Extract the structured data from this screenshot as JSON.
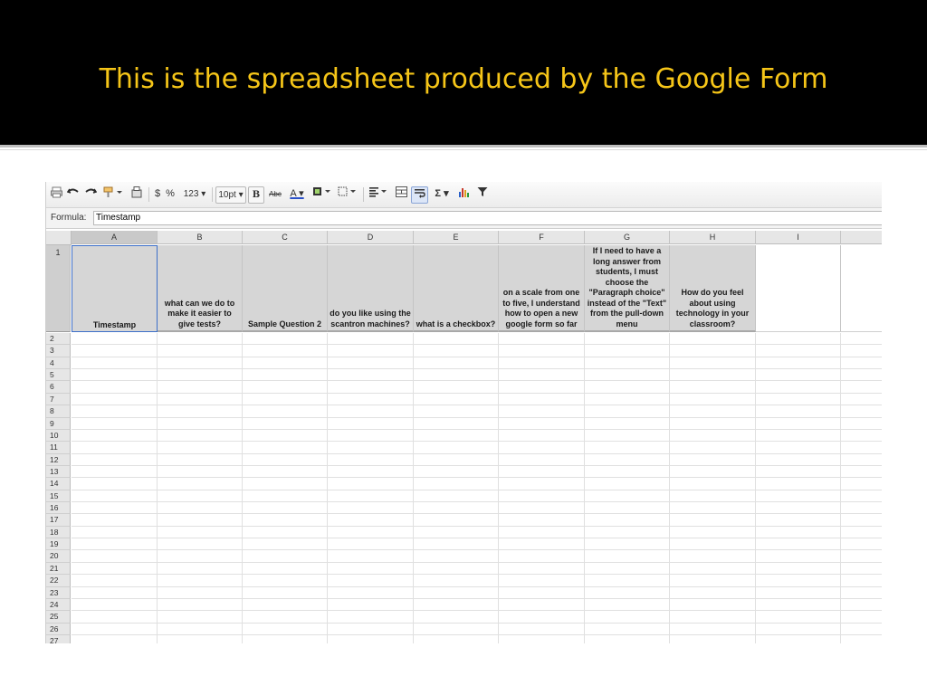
{
  "slide": {
    "title": "This is the spreadsheet produced by the Google Form",
    "title_color": "#f5c518",
    "background": "#000000"
  },
  "toolbar": {
    "buttons": [
      "print-icon",
      "undo-icon",
      "redo-icon",
      "paint-format-icon",
      "copy-icon"
    ],
    "currency": "$",
    "percent": "%",
    "number_format": "123 ▾",
    "font_size": "10pt ▾",
    "bold": "B",
    "strikethrough": "Abc",
    "text_color": "A ▾",
    "sum": "Σ ▾"
  },
  "formula": {
    "label": "Formula:",
    "value": "Timestamp"
  },
  "columns": [
    "A",
    "B",
    "C",
    "D",
    "E",
    "F",
    "G",
    "H",
    "I"
  ],
  "header_row": {
    "row_number": "1",
    "cells": [
      "Timestamp",
      "what can we do to make it easier to give tests?",
      "Sample Question 2",
      "do you like using the scantron machines?",
      "what is a checkbox?",
      "on a scale from one to five, I understand how to open a new google form so far",
      "If I need to have a long answer from students, I must choose the \"Paragraph choice\" instead of the \"Text\" from the pull-down menu",
      "How do you feel about using technology in your classroom?",
      ""
    ]
  },
  "rows": [
    "2",
    "3",
    "4",
    "5",
    "6",
    "7",
    "8",
    "9",
    "10",
    "11",
    "12",
    "13",
    "14",
    "15",
    "16",
    "17",
    "18",
    "19",
    "20",
    "21",
    "22",
    "23",
    "24",
    "25",
    "26",
    "27"
  ]
}
